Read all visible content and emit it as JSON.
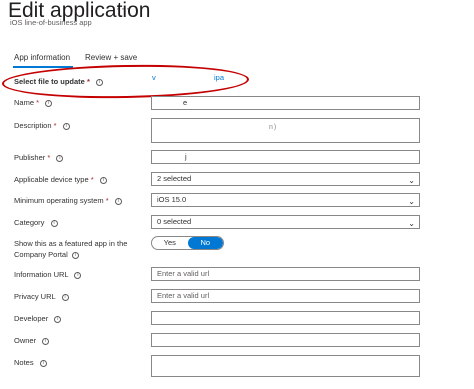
{
  "header": {
    "title": "Edit application",
    "more": "···",
    "subtitle": "iOS line-of-business app"
  },
  "tabs": [
    {
      "label": "App information",
      "selected": true
    },
    {
      "label": "Review + save",
      "selected": false
    }
  ],
  "form": {
    "file": {
      "label": "Select file to update",
      "required": "*",
      "value_a": "v",
      "value_b": "ipa"
    },
    "name": {
      "label": "Name",
      "required": "*",
      "value": "e"
    },
    "description": {
      "label": "Description",
      "required": "*",
      "value": "n)"
    },
    "publisher": {
      "label": "Publisher",
      "required": "*",
      "value": "j"
    },
    "device_type": {
      "label": "Applicable device type",
      "required": "*",
      "value": "2 selected"
    },
    "min_os": {
      "label": "Minimum operating system",
      "required": "*",
      "value": "iOS 15.0"
    },
    "category": {
      "label": "Category",
      "value": "0 selected"
    },
    "featured": {
      "label_line1": "Show this as a featured app in the",
      "label_line2": "Company Portal",
      "yes": "Yes",
      "no": "No",
      "selected": "No"
    },
    "info_url": {
      "label": "Information URL",
      "placeholder": "Enter a valid url"
    },
    "privacy_url": {
      "label": "Privacy URL",
      "placeholder": "Enter a valid url"
    },
    "developer": {
      "label": "Developer",
      "value": ""
    },
    "owner": {
      "label": "Owner",
      "value": ""
    },
    "notes": {
      "label": "Notes",
      "value": ""
    }
  },
  "icons": {
    "info": "info-icon",
    "chevron": "chevron-down-icon",
    "more": "more-icon"
  },
  "colors": {
    "accent": "#0078d4",
    "annotation": "#c40000",
    "required": "#a4262c"
  }
}
